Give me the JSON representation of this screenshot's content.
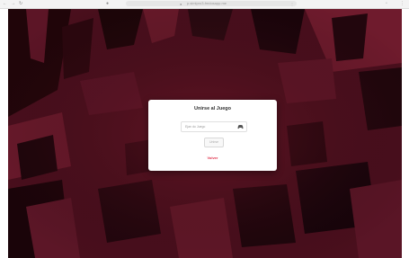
{
  "browser": {
    "url": "p.simlpro3-fmdosapp.me",
    "back_icon": "back-arrow-icon",
    "forward_icon": "forward-arrow-icon",
    "refresh_icon": "refresh-icon"
  },
  "modal": {
    "title": "Unirse al Juego",
    "code_placeholder": "Ejan do Juego",
    "join_label": "Unirse",
    "back_label": "Volver",
    "input_icon": "gamepad-icon"
  },
  "colors": {
    "background": "#3c0d17",
    "accent": "#e0344d"
  }
}
